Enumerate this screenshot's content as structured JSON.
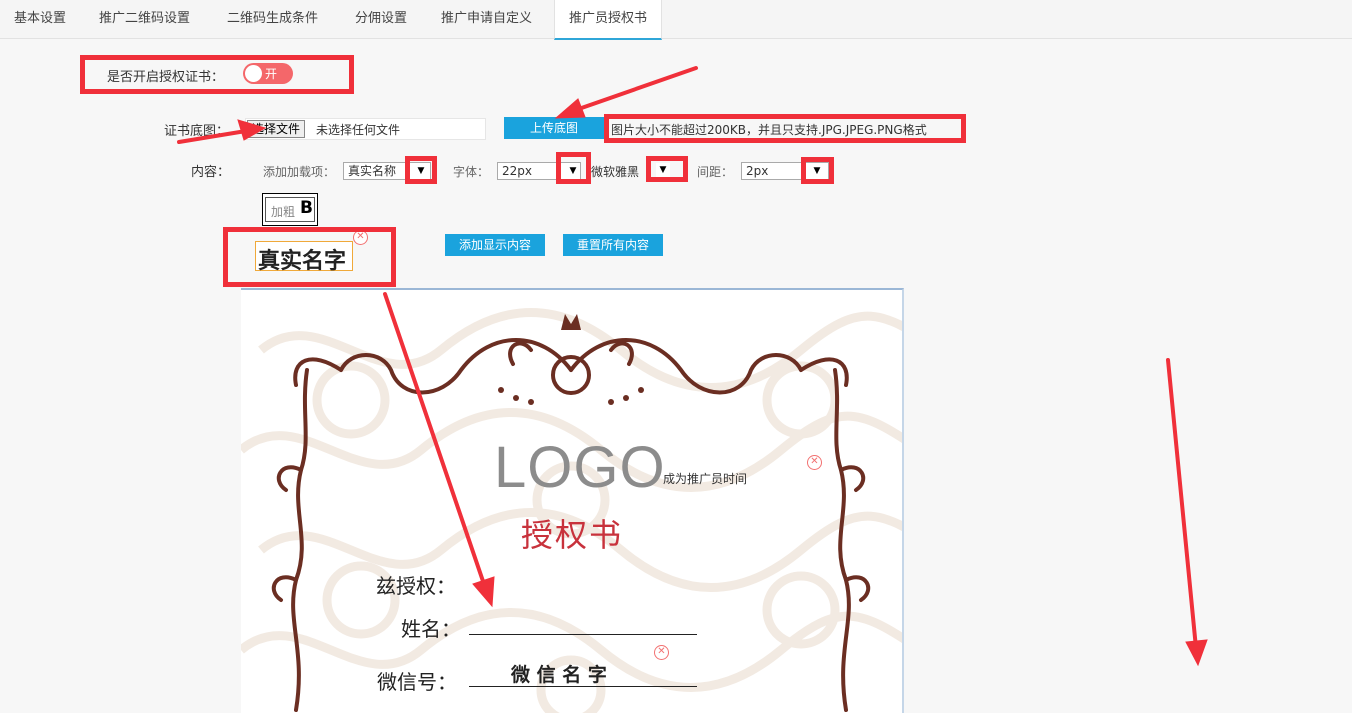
{
  "tabs": [
    {
      "label": "基本设置"
    },
    {
      "label": "推广二维码设置"
    },
    {
      "label": "二维码生成条件"
    },
    {
      "label": "分佣设置"
    },
    {
      "label": "推广申请自定义"
    },
    {
      "label": "推广员授权书"
    }
  ],
  "form": {
    "enable_label": "是否开启授权证书：",
    "enable_toggle_text": "开",
    "bg_label": "证书底图：",
    "choose_file": "选择文件",
    "no_file": "未选择任何文件",
    "upload_btn": "上传底图",
    "upload_hint": "图片大小不能超过200KB，并且只支持.JPG.JPEG.PNG格式",
    "content_label": "内容：",
    "add_item_label": "添加加载项：",
    "add_item_value": "真实名称",
    "font_label": "字体：",
    "font_size_value": "22px",
    "font_family_value": "微软雅黑",
    "spacing_label": "间距：",
    "spacing_value": "2px",
    "bold_label": "加粗",
    "bold_icon": "B",
    "preview_text": "真实名字",
    "add_content_btn": "添加显示内容",
    "reset_btn": "重置所有内容"
  },
  "certificate": {
    "logo": "LOGO",
    "time_field": "成为推广员时间",
    "title": "授权书",
    "grant": "兹授权：",
    "name_label": "姓名：",
    "wechat_label": "微信号：",
    "wechat_value": "微 信 名 字"
  },
  "icons": {
    "remove": "✕",
    "dropdown": "▼"
  },
  "colors": {
    "accent": "#1aa3dd",
    "annotation_red": "#f0303a",
    "toggle_on": "#f4676a",
    "ornament": "#6b2e22",
    "title_red": "#c8323c"
  }
}
